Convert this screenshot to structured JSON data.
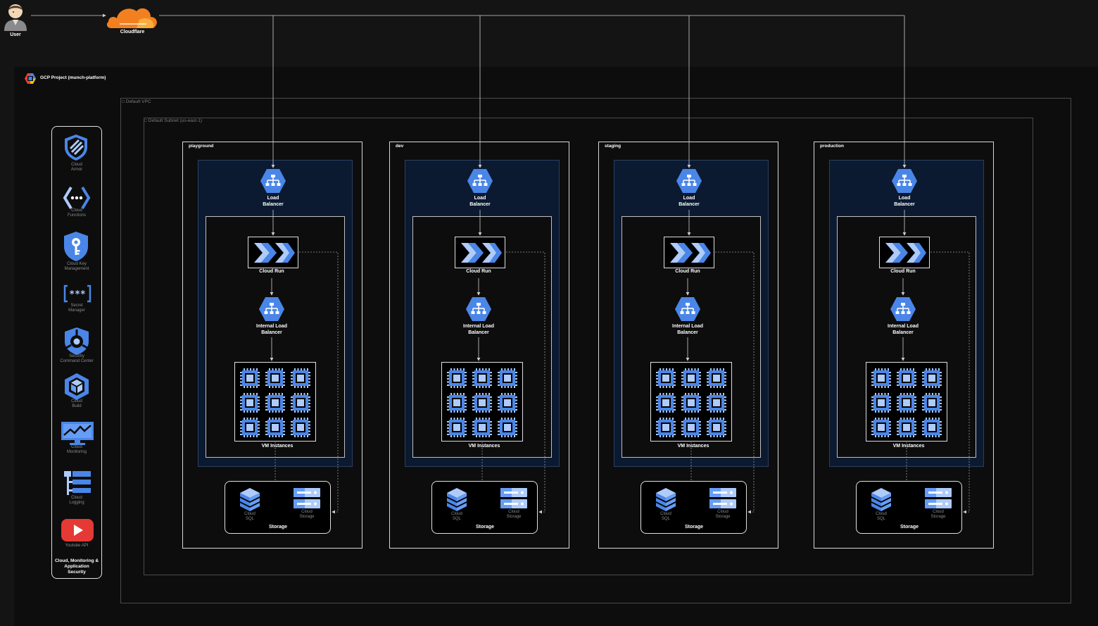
{
  "external": {
    "user_label": "User",
    "cloudflare_label": "Cloudflare"
  },
  "project": {
    "title": "GCP Project (munch-platform)",
    "vpc_label": "Default VPC",
    "subnet_label": "Default Subnet (us-east-1)"
  },
  "sidebar": {
    "items": [
      {
        "label": "Cloud\nArmor",
        "icon": "cloud-armor-icon"
      },
      {
        "label": "Cloud\nFunctions",
        "icon": "cloud-functions-icon"
      },
      {
        "label": "Cloud Key\nManagement",
        "icon": "key-management-icon"
      },
      {
        "label": "Secret\nManager",
        "icon": "secret-manager-icon"
      },
      {
        "label": "Security\nCommand Center",
        "icon": "security-command-center-icon"
      },
      {
        "label": "Cloud\nBuild",
        "icon": "cloud-build-icon"
      },
      {
        "label": "Cloud\nMonitoring",
        "icon": "cloud-monitoring-icon"
      },
      {
        "label": "Cloud\nLogging",
        "icon": "cloud-logging-icon"
      },
      {
        "label": "Youtube API",
        "icon": "youtube-icon"
      }
    ],
    "footer": "Cloud, Monitoring &\nApplication\nSecurity"
  },
  "environments": [
    {
      "name": "playground"
    },
    {
      "name": "dev"
    },
    {
      "name": "staging"
    },
    {
      "name": "production"
    }
  ],
  "labels": {
    "load_balancer": "Load\nBalancer",
    "cloud_run": "Cloud Run",
    "internal_lb": "Internal Load\nBalancer",
    "vm_instances": "VM Instances",
    "cloud_sql": "Cloud\nSQL",
    "cloud_storage": "Cloud\nStorage",
    "storage": "Storage"
  },
  "colors": {
    "gcp_blue": "#4a86e8",
    "gcp_light": "#aecbfa",
    "cloudflare_orange": "#f38020",
    "navy_panel": "#0b1a30",
    "youtube_red": "#e53935"
  }
}
